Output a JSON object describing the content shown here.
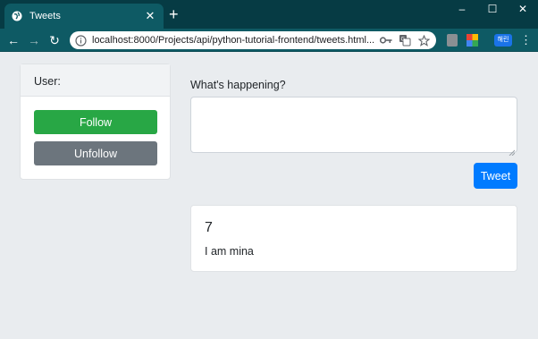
{
  "browser": {
    "tab_title": "Tweets",
    "tab_close": "✕",
    "new_tab": "+",
    "window_controls": {
      "minimize": "–",
      "maximize": "☐",
      "close": "✕"
    },
    "nav": {
      "back": "←",
      "forward": "→",
      "reload": "↻"
    },
    "url": "localhost:8000/Projects/api/python-tutorial-frontend/tweets.html...",
    "omnibox_icons": [
      "key-icon",
      "translate-icon",
      "star-icon"
    ],
    "extensions": [
      "extension-gray-icon",
      "extension-colorful-icon"
    ],
    "profile_label": "해린",
    "menu": "⋮",
    "colors": {
      "titlebar": "#063b44",
      "toolbar": "#0e5a64"
    }
  },
  "sidebar": {
    "header": "User:",
    "follow_label": "Follow",
    "unfollow_label": "Unfollow"
  },
  "compose": {
    "prompt": "What's happening?",
    "textarea_value": "",
    "submit_label": "Tweet"
  },
  "tweets": [
    {
      "id": "7",
      "text": "I am mina"
    }
  ],
  "colors": {
    "page_bg": "#e9ecef",
    "follow": "#28a745",
    "unfollow": "#6c757d",
    "tweet": "#007bff"
  }
}
